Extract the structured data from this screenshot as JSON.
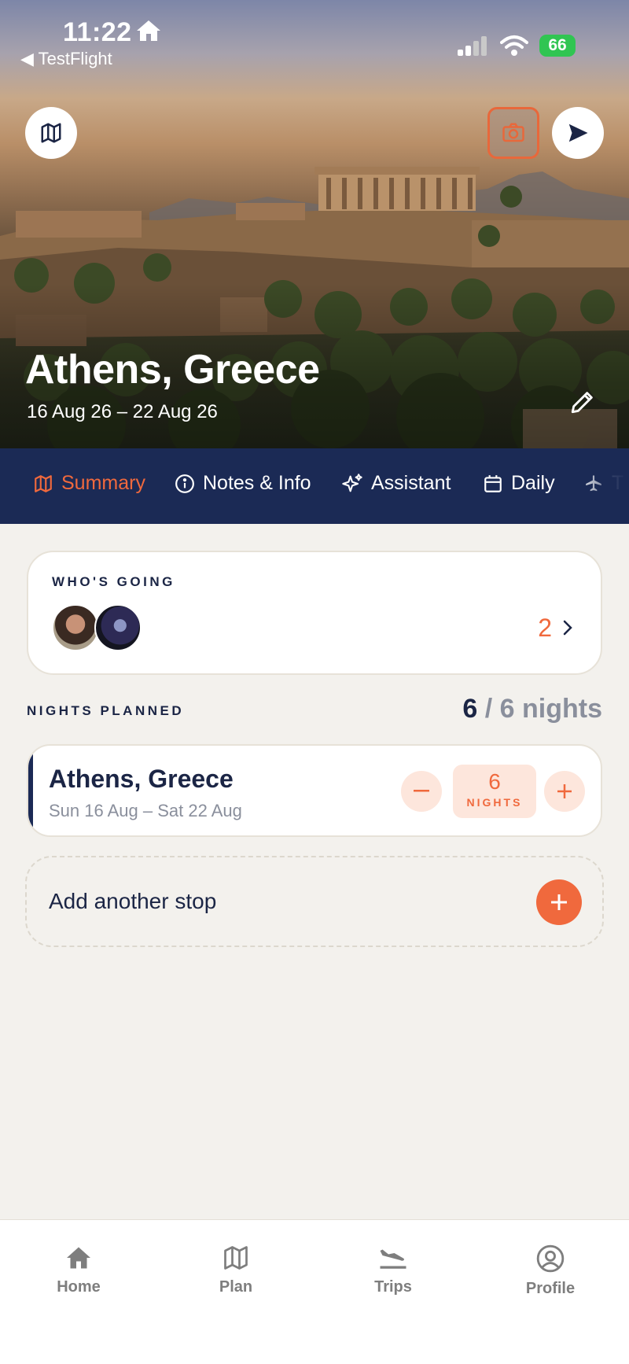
{
  "status_bar": {
    "time": "11:22",
    "back_label": "◀ TestFlight",
    "battery": "66"
  },
  "trip": {
    "title": "Athens, Greece",
    "dates": "16 Aug 26 – 22 Aug 26"
  },
  "tabs": [
    {
      "label": "Summary",
      "icon": "map-icon",
      "active": true
    },
    {
      "label": "Notes & Info",
      "icon": "info-icon"
    },
    {
      "label": "Assistant",
      "icon": "sparkle-icon"
    },
    {
      "label": "Daily",
      "icon": "calendar-icon"
    },
    {
      "label": "T",
      "icon": "plane-icon"
    }
  ],
  "whos_going": {
    "label": "WHO'S GOING",
    "count": "2"
  },
  "nights": {
    "label": "NIGHTS PLANNED",
    "planned": "6",
    "total": "/ 6 nights"
  },
  "stop": {
    "name": "Athens, Greece",
    "dates": "Sun 16 Aug – Sat 22 Aug",
    "nights": "6",
    "nights_unit": "NIGHTS"
  },
  "add_stop": {
    "label": "Add another stop"
  },
  "bottom_nav": [
    {
      "label": "Home",
      "icon": "home-icon"
    },
    {
      "label": "Plan",
      "icon": "map-icon"
    },
    {
      "label": "Trips",
      "icon": "plane-landing-icon"
    },
    {
      "label": "Profile",
      "icon": "user-circle-icon"
    }
  ],
  "colors": {
    "accent": "#f0693d",
    "navy": "#1b2a55",
    "background": "#f3f1ed"
  }
}
